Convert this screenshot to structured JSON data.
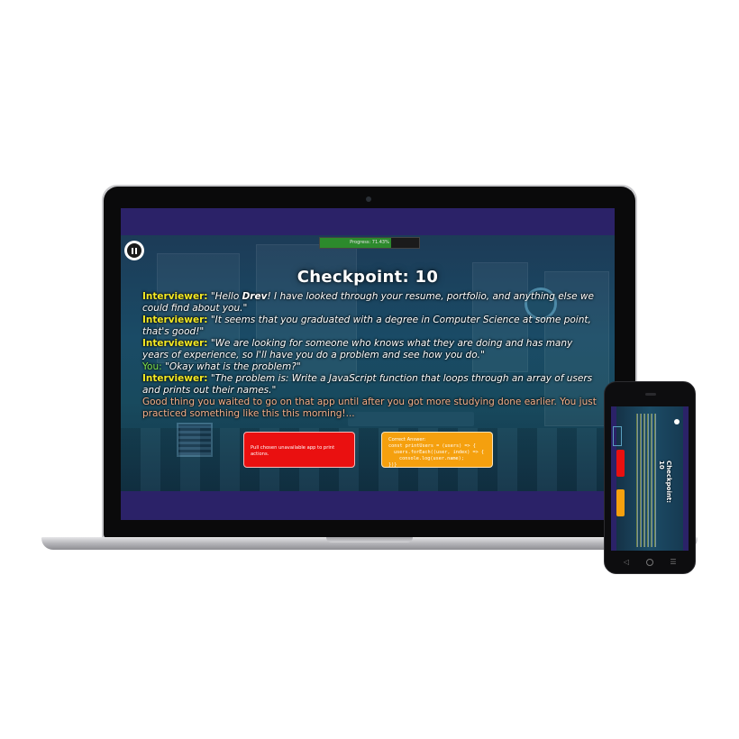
{
  "game": {
    "progress_label": "Progress: 71.43%",
    "progress_value": 0.7143,
    "checkpoint_title": "Checkpoint: 10"
  },
  "dialogue": {
    "interviewer_label": "Interviewer:",
    "you_label": "You:",
    "line1_pre": "\"Hello ",
    "line1_name": "Drev",
    "line1_post": "! I have looked through your resume, portfolio, and anything else we could find about you.\"",
    "line2": "\"It seems that you graduated with a degree in Computer Science at some point, that's good!\"",
    "line3": "\"We are looking for someone who knows what they are doing and has many years of experience, so I'll have you do a problem and see how you do.\"",
    "line4": "\"Okay what is the problem?\"",
    "line5": "\"The problem is: Write a JavaScript function that loops through an array of users and prints out their names.\"",
    "narration": "Good thing you waited to go on that app until after you got more studying done earlier. You just practiced something like this this morning!..."
  },
  "choices": {
    "option1": "Pull chosen unavailable app to print actions.",
    "option2_title": "Correct Answer:",
    "option2_code1": "const printUsers = (users) => {",
    "option2_code2": "users.forEach((user, index) => {",
    "option2_code3": "console.log(user.name);",
    "option2_code4": "})}"
  },
  "phone": {
    "checkpoint_title": "Checkpoint: 10"
  },
  "colors": {
    "frame": "#2b2268",
    "speaker": "#f5ea24",
    "you": "#7fe34a",
    "narration": "#f6b08a",
    "choice_red": "#ea1010",
    "choice_orange": "#f5a00e",
    "progress_fill": "#2c8a2c"
  },
  "icons": {
    "pause": "pause-icon",
    "phone_home": "home-button-icon"
  }
}
